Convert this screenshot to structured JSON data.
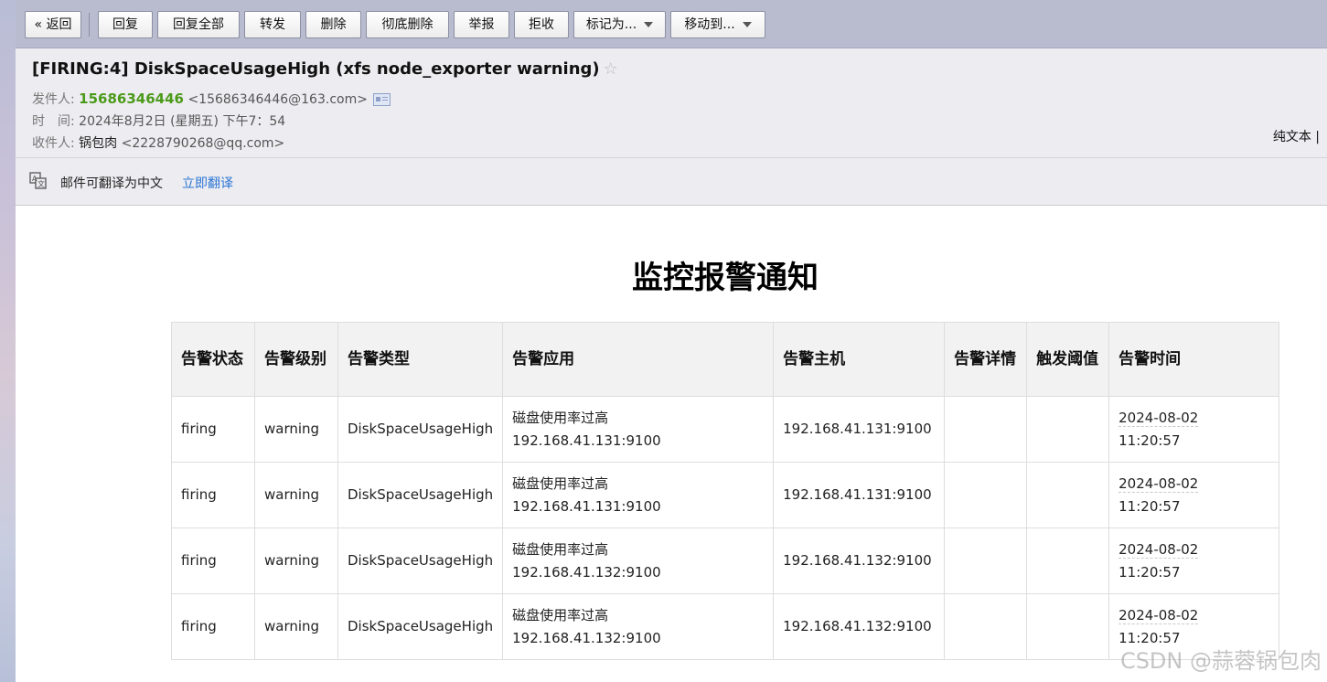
{
  "toolbar": {
    "back": "« 返回",
    "reply": "回复",
    "reply_all": "回复全部",
    "forward": "转发",
    "delete": "删除",
    "delete_permanent": "彻底删除",
    "report": "举报",
    "reject": "拒收",
    "mark_as": "标记为...",
    "move_to": "移动到..."
  },
  "header": {
    "subject": "[FIRING:4] DiskSpaceUsageHigh (xfs node_exporter warning)",
    "from_label": "发件人:",
    "from_name": "15686346446",
    "from_email": "<15686346446@163.com>",
    "time_label": "时　间:",
    "time_value": "2024年8月2日 (星期五) 下午7：54",
    "to_label": "收件人:",
    "to_name": "锅包肉",
    "to_email": "<2228790268@qq.com>",
    "plain_text": "纯文本 |"
  },
  "translate": {
    "text": "邮件可翻译为中文",
    "link": "立即翻译"
  },
  "body": {
    "title": "监控报警通知",
    "columns": [
      "告警状态",
      "告警级别",
      "告警类型",
      "告警应用",
      "告警主机",
      "告警详情",
      "触发阈值",
      "告警时间"
    ],
    "rows": [
      {
        "status": "firing",
        "level": "warning",
        "type": "DiskSpaceUsageHigh",
        "app_line1": "磁盘使用率过高",
        "app_line2": "192.168.41.131:9100",
        "host": "192.168.41.131:9100",
        "detail": "",
        "threshold": "",
        "date": "2024-08-02",
        "time": "11:20:57"
      },
      {
        "status": "firing",
        "level": "warning",
        "type": "DiskSpaceUsageHigh",
        "app_line1": "磁盘使用率过高",
        "app_line2": "192.168.41.131:9100",
        "host": "192.168.41.131:9100",
        "detail": "",
        "threshold": "",
        "date": "2024-08-02",
        "time": "11:20:57"
      },
      {
        "status": "firing",
        "level": "warning",
        "type": "DiskSpaceUsageHigh",
        "app_line1": "磁盘使用率过高",
        "app_line2": "192.168.41.132:9100",
        "host": "192.168.41.132:9100",
        "detail": "",
        "threshold": "",
        "date": "2024-08-02",
        "time": "11:20:57"
      },
      {
        "status": "firing",
        "level": "warning",
        "type": "DiskSpaceUsageHigh",
        "app_line1": "磁盘使用率过高",
        "app_line2": "192.168.41.132:9100",
        "host": "192.168.41.132:9100",
        "detail": "",
        "threshold": "",
        "date": "2024-08-02",
        "time": "11:20:57"
      }
    ]
  },
  "watermark": "CSDN @蒜蓉锅包肉",
  "icons": {
    "star": "star-icon",
    "contact_card": "contact-card-icon",
    "translate": "translate-icon",
    "dropdown": "chevron-down-icon"
  }
}
